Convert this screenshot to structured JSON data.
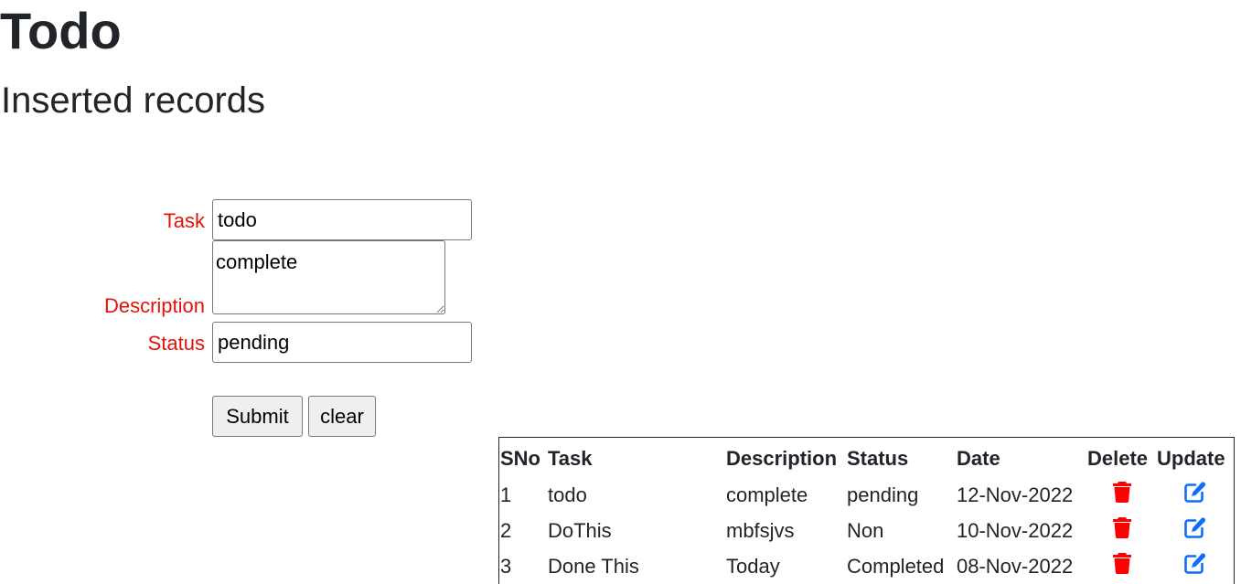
{
  "header": {
    "title": "Todo",
    "subtitle": "Inserted records"
  },
  "form": {
    "task_label": "Task",
    "task_value": "todo",
    "description_label": "Description",
    "description_value": "complete",
    "status_label": "Status",
    "status_value": "pending",
    "submit_label": "Submit",
    "clear_label": "clear"
  },
  "table": {
    "headers": [
      "SNo",
      "Task",
      "Description",
      "Status",
      "Date",
      "Delete",
      "Update"
    ],
    "rows": [
      {
        "sno": "1",
        "task": "todo",
        "description": "complete",
        "status": "pending",
        "date": "12-Nov-2022"
      },
      {
        "sno": "2",
        "task": "DoThis",
        "description": "mbfsjvs",
        "status": "Non",
        "date": "10-Nov-2022"
      },
      {
        "sno": "3",
        "task": "Done This",
        "description": "Today",
        "status": "Completed",
        "date": "08-Nov-2022"
      }
    ],
    "delete_icon": "trash-icon",
    "update_icon": "edit-icon"
  },
  "colors": {
    "label": "#e3120b",
    "delete_icon": "#ff0000",
    "update_icon": "#0d6efd",
    "text": "#212529"
  }
}
